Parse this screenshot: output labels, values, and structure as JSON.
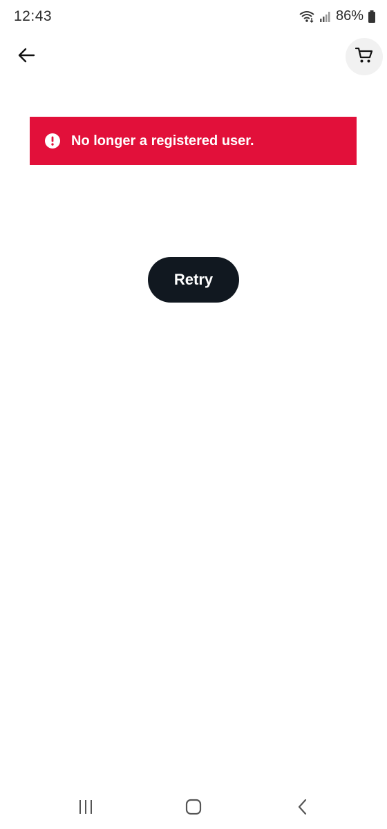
{
  "status_bar": {
    "time": "12:43",
    "battery": "86%"
  },
  "header": {
    "back_icon": "arrow-left-icon",
    "cart_icon": "shopping-cart-icon"
  },
  "error": {
    "message": "No longer a registered user.",
    "icon": "alert-circle-icon",
    "color": "#e2103a"
  },
  "actions": {
    "retry_label": "Retry"
  },
  "nav_bar": {
    "recents_icon": "recents-icon",
    "home_icon": "home-icon",
    "back_icon": "back-chevron-icon"
  }
}
